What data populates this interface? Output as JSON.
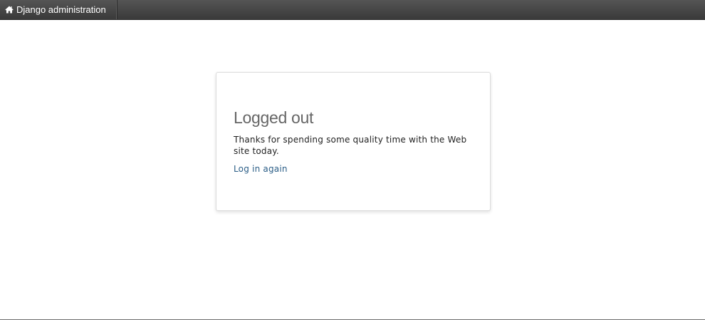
{
  "header": {
    "brand_label": "Django administration",
    "brand_icon": "home-icon"
  },
  "main": {
    "title": "Logged out",
    "message": "Thanks for spending some quality time with the Web site today.",
    "login_again_label": "Log in again"
  },
  "colors": {
    "header_bg": "#444444",
    "title": "#666666",
    "link": "#2a5d86"
  }
}
